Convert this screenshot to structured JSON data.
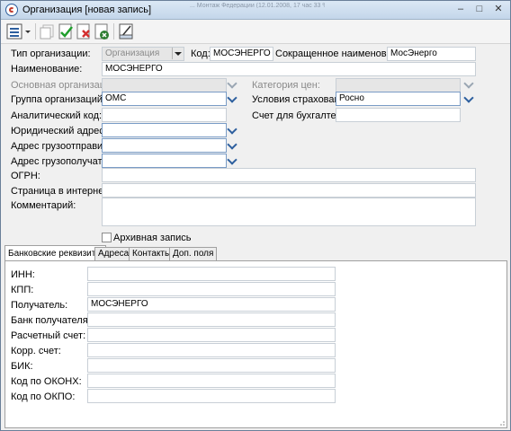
{
  "window": {
    "title": "Организация [новая запись]",
    "blurred_background_title": "... Монтаж Федерации (12.01.2008, 17 час 33 %)",
    "minimize": "–",
    "maximize": "□",
    "close": "✕"
  },
  "toolbar": {
    "buttons": [
      "menu",
      "copy",
      "save",
      "cancel-save",
      "close-record",
      "report"
    ]
  },
  "form": {
    "org_type_label": "Тип организации:",
    "org_type_value": "Организация",
    "code_label": "Код:",
    "code_value": "МОСЭНЕРГО",
    "short_name_label": "Сокращенное наименование:",
    "short_name_value": "МосЭнерго",
    "name_label": "Наименование:",
    "name_value": "МОСЭНЕРГО",
    "main_org_label": "Основная организация:",
    "main_org_value": "",
    "price_category_label": "Категория цен:",
    "price_category_value": "",
    "org_group_label": "Группа организаций:",
    "org_group_value": "ОМС",
    "insurance_label": "Условия страхования:",
    "insurance_value": "Росно",
    "analytic_code_label": "Аналитический код:",
    "analytic_code_value": "",
    "account_label": "Счет для бухгалтерии:",
    "account_value": "",
    "legal_address_label": "Юридический адрес:",
    "legal_address_value": "",
    "shipper_address_label": "Адрес грузоотправителя:",
    "shipper_address_value": "",
    "consignee_address_label": "Адрес грузополучателя:",
    "consignee_address_value": "",
    "ogrn_label": "ОГРН:",
    "ogrn_value": "",
    "website_label": "Страница в интернет:",
    "website_value": "",
    "comment_label": "Комментарий:",
    "comment_value": "",
    "archive_label": "Архивная запись",
    "archive_checked": false
  },
  "tabs": [
    {
      "label": "Банковские реквизиты",
      "active": true
    },
    {
      "label": "Адреса",
      "active": false
    },
    {
      "label": "Контакты",
      "active": false
    },
    {
      "label": "Доп. поля",
      "active": false
    }
  ],
  "bank": {
    "inn_label": "ИНН:",
    "inn_value": "",
    "kpp_label": "КПП:",
    "kpp_value": "",
    "recipient_label": "Получатель:",
    "recipient_value": "МОСЭНЕРГО",
    "bank_label": "Банк получателя:",
    "bank_value": "",
    "account_label": "Расчетный счет:",
    "account_value": "",
    "corr_label": "Корр. счет:",
    "corr_value": "",
    "bik_label": "БИК:",
    "bik_value": "",
    "okonh_label": "Код по ОКОНХ:",
    "okonh_value": "",
    "okpo_label": "Код по ОКПО:",
    "okpo_value": ""
  },
  "colors": {
    "accent": "#2d5f9e",
    "window_bg": "#f0f0f0",
    "titlebar": "#c3d6ea",
    "desktop": "#6b8db3"
  }
}
